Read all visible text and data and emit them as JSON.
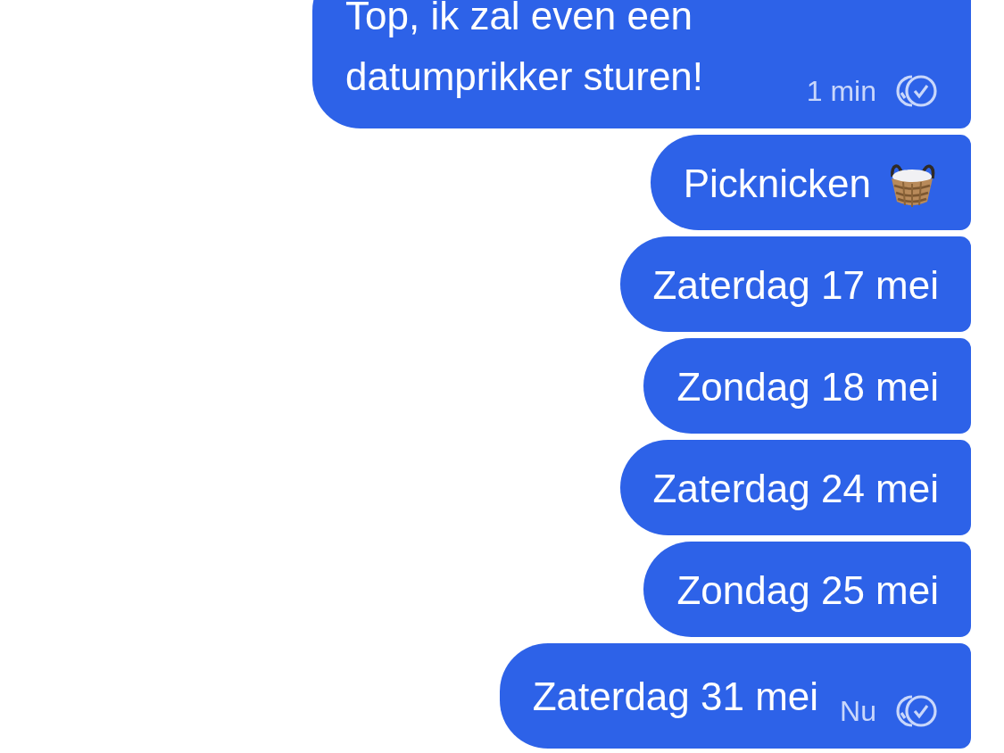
{
  "messages": [
    {
      "kind": "text",
      "text": "Top, ik zal even een datumprikker sturen!",
      "time": "1 min",
      "read": true
    },
    {
      "kind": "with-icon",
      "text": "Picknicken",
      "read": false
    },
    {
      "kind": "text",
      "text": "Zaterdag 17 mei",
      "read": false
    },
    {
      "kind": "text",
      "text": "Zondag 18 mei",
      "read": false
    },
    {
      "kind": "text",
      "text": "Zaterdag 24 mei",
      "read": false
    },
    {
      "kind": "text",
      "text": "Zondag 25 mei",
      "read": false
    },
    {
      "kind": "text",
      "text": "Zaterdag 31 mei",
      "time": "Nu",
      "read": true
    }
  ]
}
